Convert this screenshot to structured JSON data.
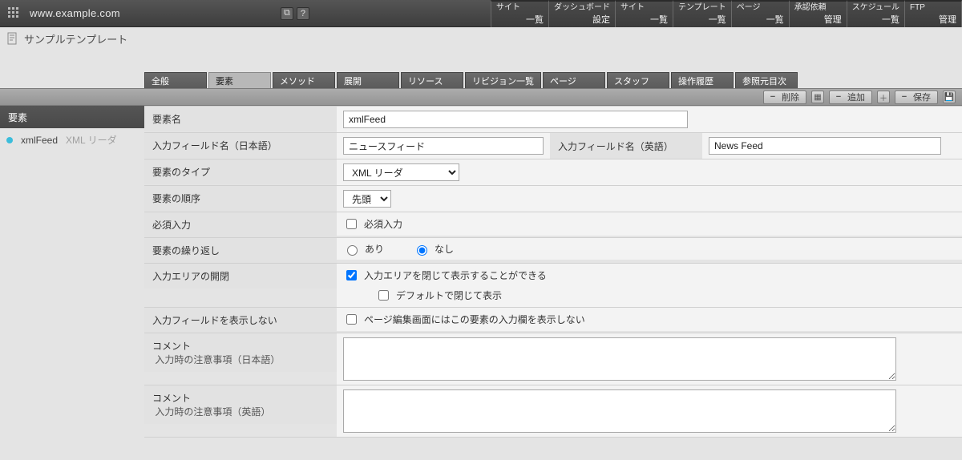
{
  "topbar": {
    "url": "www.example.com",
    "tabs": [
      {
        "t1": "サイト",
        "t2": "一覧"
      },
      {
        "t1": "ダッシュボード",
        "t2": "設定"
      },
      {
        "t1": "サイト",
        "t2": "一覧"
      },
      {
        "t1": "テンプレート",
        "t2": "一覧"
      },
      {
        "t1": "ページ",
        "t2": "一覧"
      },
      {
        "t1": "承認依頼",
        "t2": "管理"
      },
      {
        "t1": "スケジュール",
        "t2": "一覧"
      },
      {
        "t1": "FTP",
        "t2": "管理"
      }
    ]
  },
  "page_title": "サンプルテンプレート",
  "inner_tabs": [
    "全般",
    "要素",
    "メソッド",
    "展開",
    "リソース",
    "リビジョン一覧",
    "ページ",
    "スタッフ",
    "操作履歴",
    "参照元目次"
  ],
  "ribbon": {
    "delete": "削除",
    "add": "追加",
    "save": "保存"
  },
  "left": {
    "title": "要素",
    "row": {
      "name": "xmlFeed",
      "type": "XML リーダ"
    }
  },
  "form": {
    "name": {
      "label": "要素名",
      "value": "xmlFeed"
    },
    "field_ja": {
      "label": "入力フィールド名（日本語）",
      "value": "ニュースフィード"
    },
    "field_en": {
      "label": "入力フィールド名（英語）",
      "value": "News Feed"
    },
    "type": {
      "label": "要素のタイプ",
      "value": "XML リーダ"
    },
    "order": {
      "label": "要素の順序",
      "value": "先頭"
    },
    "required": {
      "label": "必須入力",
      "text": "必須入力"
    },
    "repeat": {
      "label": "要素の繰り返し",
      "yes": "あり",
      "no": "なし"
    },
    "area": {
      "label": "入力エリアの開閉",
      "l1": "入力エリアを閉じて表示することができる",
      "l2": "デフォルトで閉じて表示"
    },
    "hide": {
      "label": "入力フィールドを表示しない",
      "text": "ページ編集画面にはこの要素の入力欄を表示しない"
    },
    "comment_ja": {
      "l1": "コメント",
      "l2": "入力時の注意事項（日本語）"
    },
    "comment_en": {
      "l1": "コメント",
      "l2": "入力時の注意事項（英語）"
    }
  }
}
